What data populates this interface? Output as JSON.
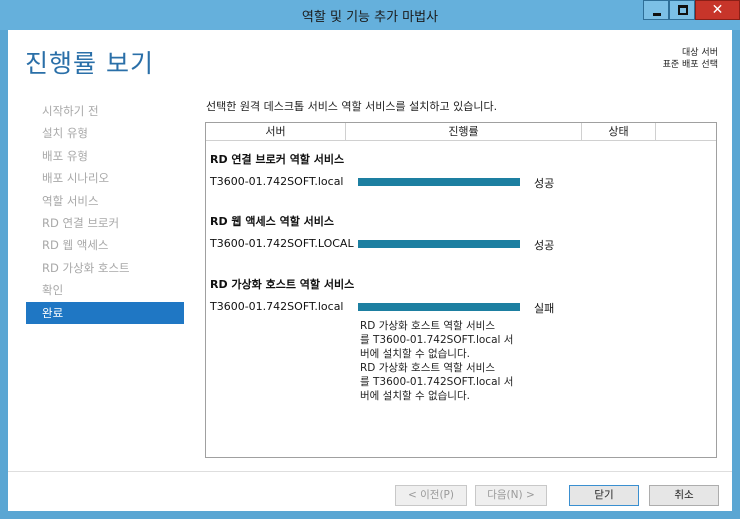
{
  "window": {
    "title": "역할 및 기능 추가 마법사",
    "controls": {
      "minimize_icon": "minimize-icon",
      "maximize_icon": "maximize-icon",
      "close_icon": "close-icon",
      "close_glyph": "✕"
    }
  },
  "header": {
    "page_title": "진행률 보기",
    "destination_label": "대상 서버",
    "destination_value": "표준 배포 선택"
  },
  "sidebar": {
    "items": [
      {
        "label": "시작하기 전"
      },
      {
        "label": "설치 유형"
      },
      {
        "label": "배포 유형"
      },
      {
        "label": "배포 시나리오"
      },
      {
        "label": "역할 서비스"
      },
      {
        "label": "RD 연결 브로커"
      },
      {
        "label": "RD 웹 액세스"
      },
      {
        "label": "RD 가상화 호스트"
      },
      {
        "label": "확인"
      },
      {
        "label": "완료",
        "active": true
      }
    ]
  },
  "main": {
    "instruction": "선택한 원격 데스크톱 서비스 역할 서비스를 설치하고 있습니다.",
    "columns": {
      "server": "서버",
      "progress": "진행률",
      "status": "상태"
    },
    "groups": [
      {
        "title": "RD 연결 브로커 역할 서비스",
        "server": "T3600-01.742SOFT.local",
        "progress": 100,
        "status": "성공"
      },
      {
        "title": "RD 웹 액세스 역할 서비스",
        "server": "T3600-01.742SOFT.LOCAL",
        "progress": 100,
        "status": "성공"
      },
      {
        "title": "RD 가상화 호스트 역할 서비스",
        "server": "T3600-01.742SOFT.local",
        "progress": 100,
        "status": "실패",
        "error_lines": [
          "RD 가상화 호스트 역할 서비스",
          "를 T3600-01.742SOFT.local 서",
          "버에 설치할 수 없습니다.",
          "RD 가상화 호스트 역할 서비스",
          "를 T3600-01.742SOFT.local 서",
          "버에 설치할 수 없습니다."
        ]
      }
    ]
  },
  "footer": {
    "prev_label": "< 이전(P)",
    "next_label": "다음(N) >",
    "close_label": "닫기",
    "cancel_label": "취소"
  },
  "colors": {
    "accent": "#1f77c4",
    "progress": "#1d7fa1",
    "title_text": "#2a6fa8",
    "frame": "#5aa6d3"
  }
}
